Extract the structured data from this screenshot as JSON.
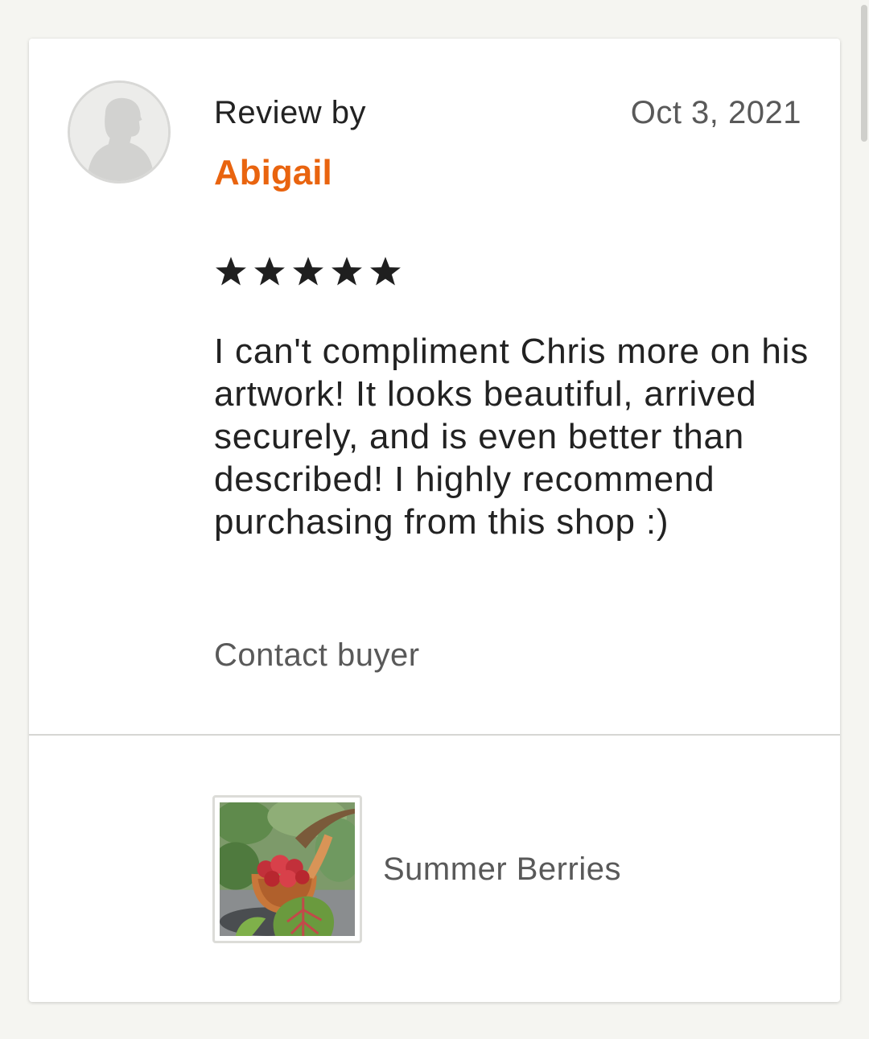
{
  "review": {
    "label": "Review by",
    "reviewer": "Abigail",
    "date": "Oct 3, 2021",
    "rating": 5,
    "rating_max": 5,
    "text": "I can't compliment Chris more on his artwork! It looks beautiful, arrived securely, and is even better than described! I highly recommend purchasing from this shop :)",
    "contact_label": "Contact buyer"
  },
  "listing": {
    "title": "Summer Berries",
    "thumbnail_icon": "berries-painting-thumbnail"
  },
  "colors": {
    "reviewer_name": "#e9640f",
    "background": "#f5f5f1",
    "card": "#ffffff",
    "text_primary": "#222222",
    "text_secondary": "#595959"
  },
  "icons": {
    "avatar": "default-user-avatar-icon",
    "star": "star-icon"
  }
}
